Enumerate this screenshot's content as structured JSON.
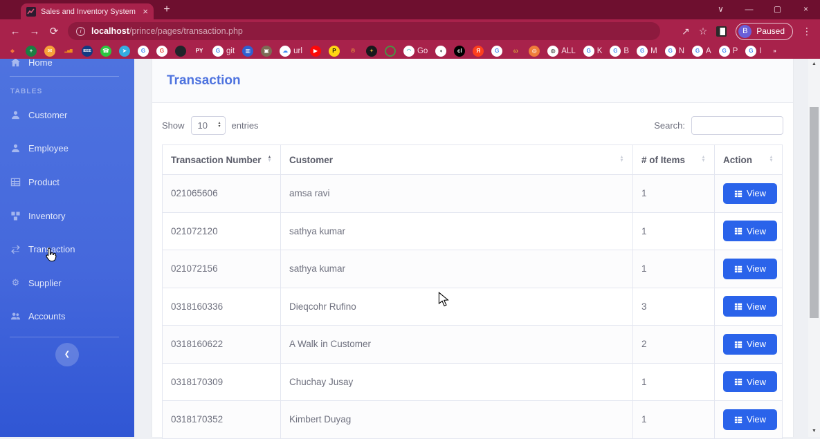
{
  "browser": {
    "tab_title": "Sales and Inventory System",
    "url_host": "localhost",
    "url_path": "/prince/pages/transaction.php",
    "profile_initial": "B",
    "profile_status": "Paused"
  },
  "glyphs": {
    "back": "←",
    "forward": "→",
    "reload": "⟳",
    "close": "×",
    "new_tab": "+",
    "menu_chevron": "∨",
    "minimize": "—",
    "maximize": "▢",
    "share": "↗",
    "star": "☆",
    "dots": "⋮",
    "info": "i",
    "sort_up": "▲",
    "sort_down": "▼",
    "select_up": "▴",
    "select_down": "▾",
    "scroll_up": "▲",
    "scroll_down": "▼",
    "sidebar_collapse": "❮",
    "overflow": "»",
    "supplier_gear": "⚙"
  },
  "colors": {
    "chrome_titlebar": "#6e0f2f",
    "chrome_toolbar": "#a8224b",
    "urlbar": "#8d1a3e",
    "sidebar_top": "#4e73df",
    "sidebar_bottom": "#3056d4",
    "accent_blue": "#4e73df",
    "view_button_blue": "#2a63ea",
    "table_border": "#e3e6f0",
    "text_gray": "#6e707e"
  },
  "bookmarks": {
    "items": [
      {
        "name": "flame-icon",
        "glyph": "◆",
        "bg": "none",
        "fg": "#f4743b"
      },
      {
        "name": "sheets-icon",
        "glyph": "+",
        "bg": "#1b7e43",
        "fg": "#ffffff"
      },
      {
        "name": "mail-icon",
        "glyph": "✉",
        "bg": "#f6a13a",
        "fg": "#ffffff"
      },
      {
        "name": "analytics-icon",
        "glyph": "▂▅▇",
        "bg": "none",
        "fg": "#ef8c1d"
      },
      {
        "name": "ieee-icon",
        "glyph": "IEEE",
        "bg": "#123a82",
        "fg": "#ffffff"
      },
      {
        "name": "whatsapp-icon",
        "glyph": "☎",
        "bg": "#2bc740",
        "fg": "#ffffff"
      },
      {
        "name": "telegram-icon",
        "glyph": "➤",
        "bg": "#35ace0",
        "fg": "#ffffff"
      },
      {
        "name": "google-icon",
        "glyph": "G",
        "bg": "#ffffff",
        "fg": "#4285f4"
      },
      {
        "name": "google-icon",
        "glyph": "G",
        "bg": "#ffffff",
        "fg": "#ea4335"
      },
      {
        "name": "github-icon",
        "glyph": "",
        "bg": "#20242a",
        "fg": "#ffffff"
      },
      {
        "name": "python-bookmark",
        "glyph": "PY",
        "bg": "none",
        "fg": "#ffffff"
      },
      {
        "name": "google-icon",
        "glyph": "G",
        "bg": "#ffffff",
        "fg": "#4285f4",
        "label": "git"
      },
      {
        "name": "image-icon",
        "glyph": "▥",
        "bg": "#2f5fd0",
        "fg": "#ffffff"
      },
      {
        "name": "camera-icon",
        "glyph": "▣",
        "bg": "#7d6a55",
        "fg": "#ffffff"
      },
      {
        "name": "cloud-icon",
        "glyph": "☁",
        "bg": "#ffffff",
        "fg": "#3d87f5",
        "label": "url"
      },
      {
        "name": "youtube-icon",
        "glyph": "▶",
        "bg": "#fd0808",
        "fg": "#ffffff"
      },
      {
        "name": "p-icon",
        "glyph": "P",
        "bg": "#ffd613",
        "fg": "#111111"
      },
      {
        "name": "movie-icon",
        "glyph": "✇",
        "bg": "none",
        "fg": "#f0a23c"
      },
      {
        "name": "crest-icon",
        "glyph": "✦",
        "bg": "#17181c",
        "fg": "#d8a23c"
      },
      {
        "name": "ring-icon",
        "glyph": "",
        "bg": "none",
        "fg": "#4d8f45",
        "ring": true
      },
      {
        "name": "godaddy-icon",
        "glyph": "◠",
        "bg": "#ffffff",
        "fg": "#11a9b5",
        "label": "Go"
      },
      {
        "name": "duck-icon",
        "glyph": "◖",
        "bg": "#ffffff",
        "fg": "#111111"
      },
      {
        "name": "cl-icon",
        "glyph": "cl",
        "bg": "#000000",
        "fg": "#ffffff"
      },
      {
        "name": "yandex-icon",
        "glyph": "Я",
        "bg": "#fc3f1d",
        "fg": "#ffffff"
      },
      {
        "name": "google-icon",
        "glyph": "G",
        "bg": "#ffffff",
        "fg": "#4285f4"
      },
      {
        "name": "swoosh-icon",
        "glyph": "ω",
        "bg": "none",
        "fg": "#d9a43a"
      },
      {
        "name": "camera-orange-icon",
        "glyph": "◎",
        "bg": "#ef7d3a",
        "fg": "#ffffff"
      },
      {
        "name": "globe-icon",
        "glyph": "◍",
        "bg": "#ffffff",
        "fg": "#333333",
        "label": "ALL"
      },
      {
        "name": "google-icon",
        "glyph": "G",
        "bg": "#ffffff",
        "fg": "#4285f4",
        "label": "K"
      },
      {
        "name": "google-icon",
        "glyph": "G",
        "bg": "#ffffff",
        "fg": "#4285f4",
        "label": "B"
      },
      {
        "name": "google-icon",
        "glyph": "G",
        "bg": "#ffffff",
        "fg": "#4285f4",
        "label": "M"
      },
      {
        "name": "google-icon",
        "glyph": "G",
        "bg": "#ffffff",
        "fg": "#4285f4",
        "label": "N"
      },
      {
        "name": "google-icon",
        "glyph": "G",
        "bg": "#ffffff",
        "fg": "#4285f4",
        "label": "A"
      },
      {
        "name": "google-icon",
        "glyph": "G",
        "bg": "#ffffff",
        "fg": "#4285f4",
        "label": "P"
      },
      {
        "name": "google-icon",
        "glyph": "G",
        "bg": "#ffffff",
        "fg": "#4285f4",
        "label": "I"
      },
      {
        "name": "bookmarks-overflow",
        "glyph": "»",
        "bg": "none",
        "fg": "#f7dfe8"
      }
    ]
  },
  "sidebar": {
    "section_label": "TABLES",
    "items": [
      {
        "label": "Home"
      },
      {
        "label": "Customer"
      },
      {
        "label": "Employee"
      },
      {
        "label": "Product"
      },
      {
        "label": "Inventory"
      },
      {
        "label": "Transaction"
      },
      {
        "label": "Supplier"
      },
      {
        "label": "Accounts"
      }
    ]
  },
  "page": {
    "title": "Transaction",
    "length_menu": {
      "show": "Show",
      "value": "10",
      "entries": "entries"
    },
    "search": {
      "label": "Search:",
      "value": ""
    },
    "table": {
      "view_label": "View",
      "columns": [
        {
          "label": "Transaction Number",
          "sorted": "asc"
        },
        {
          "label": "Customer",
          "sorted": "none"
        },
        {
          "label": "# of Items",
          "sorted": "none"
        },
        {
          "label": "Action",
          "sorted": "none"
        }
      ],
      "rows": [
        {
          "number": "021065606",
          "customer": "amsa ravi",
          "items": "1"
        },
        {
          "number": "021072120",
          "customer": "sathya kumar",
          "items": "1"
        },
        {
          "number": "021072156",
          "customer": "sathya kumar",
          "items": "1"
        },
        {
          "number": "0318160336",
          "customer": "Dieqcohr Rufino",
          "items": "3"
        },
        {
          "number": "0318160622",
          "customer": "A Walk in Customer",
          "items": "2"
        },
        {
          "number": "0318170309",
          "customer": "Chuchay Jusay",
          "items": "1"
        },
        {
          "number": "0318170352",
          "customer": "Kimbert Duyag",
          "items": "1"
        }
      ]
    }
  }
}
